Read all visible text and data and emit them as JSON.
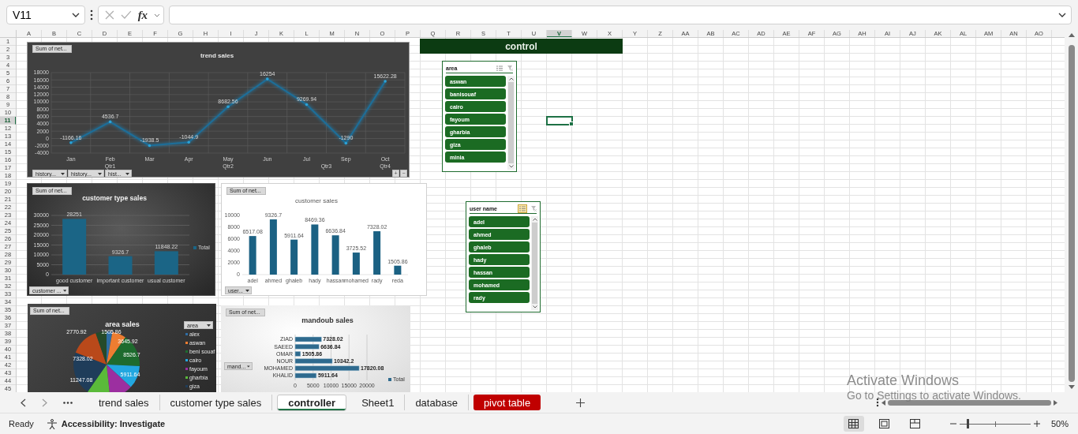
{
  "formula_bar": {
    "name_box": "V11",
    "fx": "fx"
  },
  "columns": [
    {
      "label": "A",
      "selected": false
    },
    {
      "label": "B",
      "selected": false
    },
    {
      "label": "C",
      "selected": false
    },
    {
      "label": "D",
      "selected": false
    },
    {
      "label": "E",
      "selected": false
    },
    {
      "label": "F",
      "selected": false
    },
    {
      "label": "G",
      "selected": false
    },
    {
      "label": "H",
      "selected": false
    },
    {
      "label": "I",
      "selected": false
    },
    {
      "label": "J",
      "selected": false
    },
    {
      "label": "K",
      "selected": false
    },
    {
      "label": "L",
      "selected": false
    },
    {
      "label": "M",
      "selected": false
    },
    {
      "label": "N",
      "selected": false
    },
    {
      "label": "O",
      "selected": false
    },
    {
      "label": "P",
      "selected": false
    },
    {
      "label": "Q",
      "selected": false
    },
    {
      "label": "R",
      "selected": false
    },
    {
      "label": "S",
      "selected": false
    },
    {
      "label": "T",
      "selected": false
    },
    {
      "label": "U",
      "selected": false
    },
    {
      "label": "V",
      "selected": true
    },
    {
      "label": "W",
      "selected": false
    },
    {
      "label": "X",
      "selected": false
    },
    {
      "label": "Y",
      "selected": false
    },
    {
      "label": "Z",
      "selected": false
    },
    {
      "label": "AA",
      "selected": false
    },
    {
      "label": "AB",
      "selected": false
    },
    {
      "label": "AC",
      "selected": false
    },
    {
      "label": "AD",
      "selected": false
    },
    {
      "label": "AE",
      "selected": false
    },
    {
      "label": "AF",
      "selected": false
    },
    {
      "label": "AG",
      "selected": false
    },
    {
      "label": "AH",
      "selected": false
    },
    {
      "label": "AI",
      "selected": false
    },
    {
      "label": "AJ",
      "selected": false
    },
    {
      "label": "AK",
      "selected": false
    },
    {
      "label": "AL",
      "selected": false
    },
    {
      "label": "AM",
      "selected": false
    },
    {
      "label": "AN",
      "selected": false
    },
    {
      "label": "AO",
      "selected": false
    }
  ],
  "rows": [
    {
      "label": "1",
      "selected": false
    },
    {
      "label": "2",
      "selected": false
    },
    {
      "label": "3",
      "selected": false
    },
    {
      "label": "4",
      "selected": false
    },
    {
      "label": "5",
      "selected": false
    },
    {
      "label": "6",
      "selected": false
    },
    {
      "label": "7",
      "selected": false
    },
    {
      "label": "8",
      "selected": false
    },
    {
      "label": "9",
      "selected": false
    },
    {
      "label": "10",
      "selected": false
    },
    {
      "label": "11",
      "selected": true
    },
    {
      "label": "12",
      "selected": false
    },
    {
      "label": "13",
      "selected": false
    },
    {
      "label": "14",
      "selected": false
    },
    {
      "label": "15",
      "selected": false
    },
    {
      "label": "16",
      "selected": false
    },
    {
      "label": "17",
      "selected": false
    },
    {
      "label": "18",
      "selected": false
    },
    {
      "label": "19",
      "selected": false
    },
    {
      "label": "20",
      "selected": false
    },
    {
      "label": "21",
      "selected": false
    },
    {
      "label": "22",
      "selected": false
    },
    {
      "label": "23",
      "selected": false
    },
    {
      "label": "24",
      "selected": false
    },
    {
      "label": "25",
      "selected": false
    },
    {
      "label": "26",
      "selected": false
    },
    {
      "label": "27",
      "selected": false
    },
    {
      "label": "28",
      "selected": false
    },
    {
      "label": "29",
      "selected": false
    },
    {
      "label": "30",
      "selected": false
    },
    {
      "label": "31",
      "selected": false
    },
    {
      "label": "32",
      "selected": false
    },
    {
      "label": "33",
      "selected": false
    },
    {
      "label": "34",
      "selected": false
    },
    {
      "label": "35",
      "selected": false
    },
    {
      "label": "36",
      "selected": false
    },
    {
      "label": "37",
      "selected": false
    },
    {
      "label": "38",
      "selected": false
    },
    {
      "label": "39",
      "selected": false
    },
    {
      "label": "40",
      "selected": false
    },
    {
      "label": "41",
      "selected": false
    },
    {
      "label": "42",
      "selected": false
    },
    {
      "label": "43",
      "selected": false
    },
    {
      "label": "44",
      "selected": false
    },
    {
      "label": "45",
      "selected": false
    }
  ],
  "charts": [
    {
      "field_button": "Sum of net...",
      "filters": [
        "history...",
        "history...",
        "hist..."
      ],
      "quarters": [
        "Qtr1",
        "Qtr2",
        "Qtr3",
        "Qtr4"
      ],
      "zoom_buttons": [
        "+",
        "−"
      ],
      "chart_data": {
        "type": "line",
        "title": "trend sales",
        "categories": [
          "Jan",
          "Feb",
          "Mar",
          "Apr",
          "May",
          "Jun",
          "Jul",
          "Sep",
          "Oct"
        ],
        "values": [
          -1166.16,
          4536.7,
          -1938.5,
          -1044.9,
          8682.56,
          16254,
          9269.94,
          -1290,
          15622.28
        ],
        "ylim": [
          -4000,
          18000
        ],
        "yticks": [
          -4000,
          -2000,
          0,
          2000,
          4000,
          6000,
          8000,
          10000,
          12000,
          14000,
          16000,
          18000
        ],
        "grid": true,
        "data_labels": true
      }
    },
    {
      "field_button": "Sum of net...",
      "filters": [
        "customer ..."
      ],
      "legend": true,
      "chart_data": {
        "type": "bar",
        "title": "customer type sales",
        "categories": [
          "good customer",
          "important customer",
          "usual customer"
        ],
        "series": [
          {
            "name": "Total",
            "color": "#1b6586",
            "values": [
              28251,
              9326.7,
              11848.22
            ]
          }
        ],
        "ylim": [
          0,
          30000
        ],
        "yticks": [
          0,
          5000,
          10000,
          15000,
          20000,
          25000,
          30000
        ],
        "grid": true,
        "data_labels": true
      }
    },
    {
      "field_button": "Sum of net...",
      "filters": [
        "user..."
      ],
      "chart_data": {
        "type": "bar",
        "title": "customer sales",
        "categories": [
          "adel",
          "ahmed",
          "ghaleb",
          "hady",
          "hassan",
          "mohamed",
          "rady",
          "reda"
        ],
        "values": [
          6517.08,
          9326.7,
          5911.64,
          8469.36,
          6636.84,
          3725.52,
          7328.02,
          1505.86
        ],
        "ylim": [
          0,
          10000
        ],
        "yticks": [
          0,
          2000,
          4000,
          6000,
          8000,
          10000
        ],
        "data_labels": true
      }
    },
    {
      "kind": "pie",
      "title": "area sales",
      "field_button": "Sum of net...",
      "legend_filter": "area",
      "data_labels": [
        "2770.92",
        "1505.86",
        "3645.92",
        "8526.7",
        "7328.02",
        "5911.64",
        "11247.08"
      ],
      "legend": [
        {
          "label": "alex",
          "color": "#2e6da4"
        },
        {
          "label": "aswan",
          "color": "#ed7d31"
        },
        {
          "label": "beni souaf",
          "color": "#1e6b2e"
        },
        {
          "label": "cairo",
          "color": "#22a7e0"
        },
        {
          "label": "fayoum",
          "color": "#9c2fa0"
        },
        {
          "label": "gharbia",
          "color": "#5aba3a"
        },
        {
          "label": "giza",
          "color": "#1f3d5a"
        }
      ]
    },
    {
      "field_button": "Sum of net...",
      "filters": [
        "mand..."
      ],
      "legend": true,
      "chart_data": {
        "type": "bar",
        "orientation": "horizontal",
        "title": "mandoub sales",
        "categories": [
          "ZIAD",
          "SAEED",
          "OMAR",
          "NOUR",
          "MOHAMED",
          "KHALID"
        ],
        "series": [
          {
            "name": "Total",
            "color": "#2e6a8e",
            "values": [
              7328.02,
              6636.84,
              1505.86,
              10342.2,
              17820.08,
              5911.64
            ]
          }
        ],
        "xlim": [
          0,
          20000
        ],
        "xticks": [
          0,
          5000,
          10000,
          15000,
          20000
        ],
        "grid": true,
        "data_labels": true
      }
    }
  ],
  "control_header": "control",
  "slicers": [
    {
      "title": "area",
      "multi_select": false,
      "items": [
        {
          "label": "aswan",
          "selected": true
        },
        {
          "label": "banisouaf",
          "selected": true
        },
        {
          "label": "cairo",
          "selected": true
        },
        {
          "label": "fayoum",
          "selected": true
        },
        {
          "label": "gharbia",
          "selected": true
        },
        {
          "label": "giza",
          "selected": true
        },
        {
          "label": "minia",
          "selected": true
        }
      ]
    },
    {
      "title": "user name",
      "multi_select": true,
      "items": [
        {
          "label": "adel",
          "selected": true
        },
        {
          "label": "ahmed",
          "selected": true
        },
        {
          "label": "ghaleb",
          "selected": true
        },
        {
          "label": "hady",
          "selected": true
        },
        {
          "label": "hassan",
          "selected": true
        },
        {
          "label": "mohamed",
          "selected": true
        },
        {
          "label": "rady",
          "selected": true
        }
      ]
    }
  ],
  "sheet_tabs": [
    {
      "label": "trend sales",
      "selected": false
    },
    {
      "label": "customer type sales",
      "selected": false
    },
    {
      "label": "controller",
      "selected": true
    },
    {
      "label": "Sheet1",
      "selected": false
    },
    {
      "label": "database",
      "selected": false
    },
    {
      "label": "pivot table",
      "selected": false,
      "color": "#c00000"
    }
  ],
  "status_bar": {
    "ready": "Ready",
    "accessibility": "Accessibility: Investigate",
    "views": [
      {
        "kind": "normal",
        "selected": true
      },
      {
        "kind": "page_layout",
        "selected": false
      },
      {
        "kind": "page_break",
        "selected": false
      }
    ],
    "zoom": {
      "level": 0.12,
      "reading": "50%"
    }
  },
  "activation": {
    "title": "Activate Windows",
    "subtitle": "Go to Settings to activate Windows."
  }
}
